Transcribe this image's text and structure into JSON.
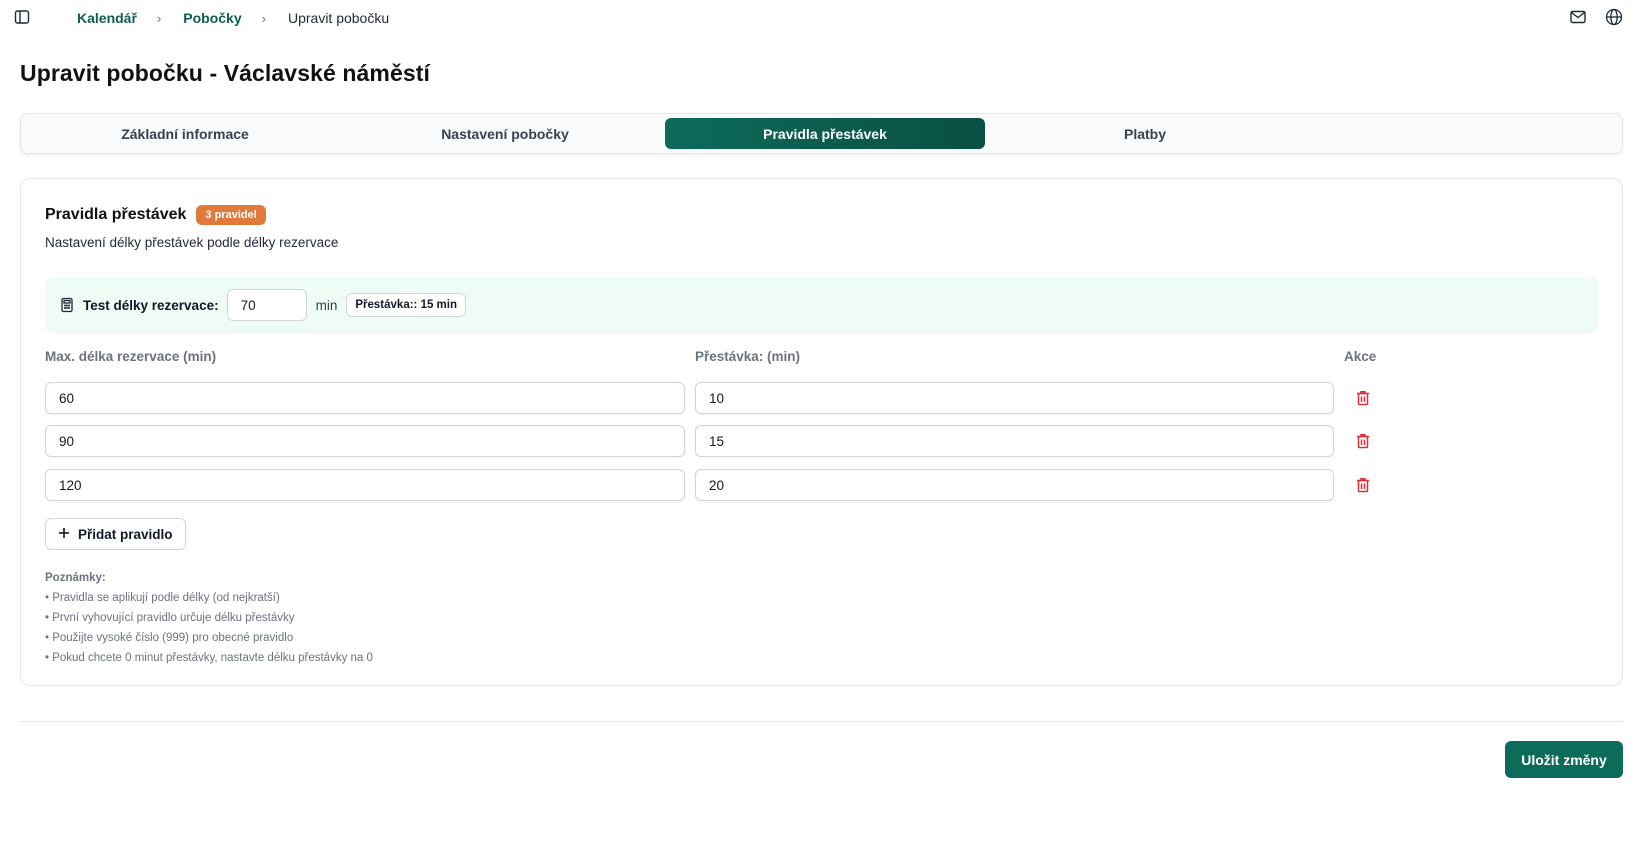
{
  "breadcrumb": {
    "items": [
      "Kalendář",
      "Pobočky"
    ],
    "current": "Upravit pobočku"
  },
  "page": {
    "title": "Upravit pobočku - Václavské náměstí"
  },
  "tabs": [
    {
      "label": "Základní informace",
      "active": false
    },
    {
      "label": "Nastavení pobočky",
      "active": false
    },
    {
      "label": "Pravidla přestávek",
      "active": true
    },
    {
      "label": "Platby",
      "active": false
    }
  ],
  "section": {
    "title": "Pravidla přestávek",
    "badge": "3 pravidel",
    "subtitle": "Nastavení délky přestávek podle délky rezervace"
  },
  "test": {
    "label": "Test délky rezervace:",
    "value": "70",
    "unit": "min",
    "result": "Přestávka:: 15 min"
  },
  "table": {
    "headers": [
      "Max. délka rezervace (min)",
      "Přestávka: (min)",
      "Akce"
    ],
    "rows": [
      {
        "max": "60",
        "break": "10"
      },
      {
        "max": "90",
        "break": "15"
      },
      {
        "max": "120",
        "break": "20"
      }
    ]
  },
  "add_button": "Přidat pravidlo",
  "notes": {
    "title": "Poznámky:",
    "items": [
      "• Pravidla se aplikují podle délky (od nejkratší)",
      "• První vyhovující pravidlo určuje délku přestávky",
      "• Použijte vysoké číslo (999) pro obecné pravidlo",
      "• Pokud chcete 0 minut přestávky, nastavte délku přestávky na 0"
    ]
  },
  "save_button": "Uložit změny",
  "colors": {
    "primary": "#0d6b5a",
    "badge": "#e07a3c",
    "delete": "#d9303a",
    "panel": "#effcf6"
  },
  "icons": {
    "sidebar": "sidebar-toggle-icon",
    "mail": "mail-icon",
    "language": "globe-icon",
    "calculator": "calculator-icon",
    "delete": "trash-icon",
    "add": "plus-icon"
  }
}
